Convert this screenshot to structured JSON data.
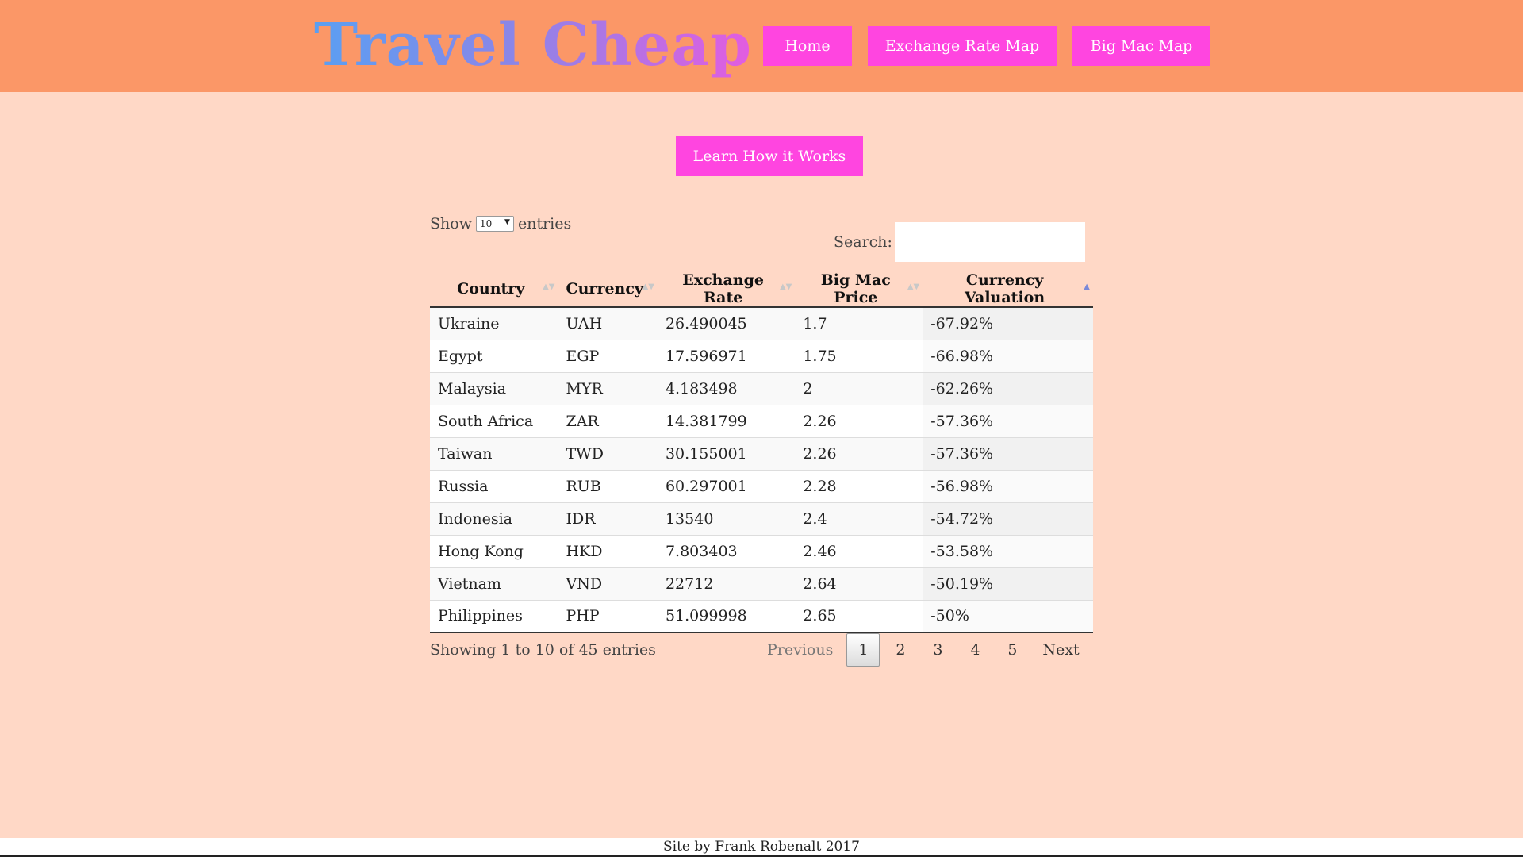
{
  "header": {
    "logo_text": "Travel Cheap",
    "nav": [
      {
        "label": "Home"
      },
      {
        "label": "Exchange Rate Map"
      },
      {
        "label": "Big Mac Map"
      }
    ]
  },
  "learn_button_label": "Learn How it Works",
  "table_controls": {
    "show_label": "Show",
    "entries_label": "entries",
    "length_selected": "10",
    "search_label": "Search:",
    "search_value": ""
  },
  "table": {
    "columns": [
      "Country",
      "Currency",
      "Exchange Rate",
      "Big Mac Price",
      "Currency Valuation"
    ],
    "sorted_column": "Currency Valuation",
    "sort_direction": "ascending",
    "rows": [
      [
        "Ukraine",
        "UAH",
        "26.490045",
        "1.7",
        "-67.92%"
      ],
      [
        "Egypt",
        "EGP",
        "17.596971",
        "1.75",
        "-66.98%"
      ],
      [
        "Malaysia",
        "MYR",
        "4.183498",
        "2",
        "-62.26%"
      ],
      [
        "South Africa",
        "ZAR",
        "14.381799",
        "2.26",
        "-57.36%"
      ],
      [
        "Taiwan",
        "TWD",
        "30.155001",
        "2.26",
        "-57.36%"
      ],
      [
        "Russia",
        "RUB",
        "60.297001",
        "2.28",
        "-56.98%"
      ],
      [
        "Indonesia",
        "IDR",
        "13540",
        "2.4",
        "-54.72%"
      ],
      [
        "Hong Kong",
        "HKD",
        "7.803403",
        "2.46",
        "-53.58%"
      ],
      [
        "Vietnam",
        "VND",
        "22712",
        "2.64",
        "-50.19%"
      ],
      [
        "Philippines",
        "PHP",
        "51.099998",
        "2.65",
        "-50%"
      ]
    ]
  },
  "info_text": "Showing 1 to 10 of 45 entries",
  "pagination": {
    "previous": "Previous",
    "pages": [
      "1",
      "2",
      "3",
      "4",
      "5"
    ],
    "current": "1",
    "next": "Next"
  },
  "footer_text": "Site by Frank Robenalt 2017",
  "colors": {
    "header_bg": "#fb9767",
    "page_bg": "#ffd8c6",
    "button_bg": "#ff45e0"
  }
}
